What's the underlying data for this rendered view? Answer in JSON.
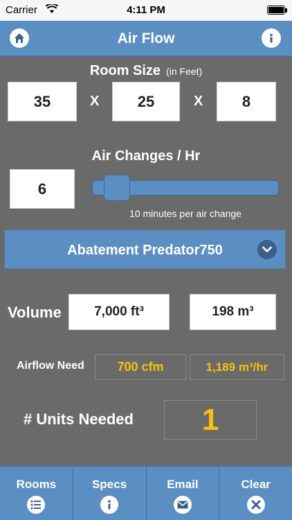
{
  "status_bar": {
    "carrier": "Carrier",
    "time": "4:11 PM"
  },
  "nav": {
    "title": "Air Flow",
    "home_icon": "home-icon",
    "info_icon": "info-icon"
  },
  "room_size": {
    "title": "Room Size",
    "unit_note": "(in Feet)",
    "length": "35",
    "width": "25",
    "height": "8",
    "separator": "X"
  },
  "air_changes": {
    "title": "Air Changes / Hr",
    "value": "6",
    "slider_level": 0.07,
    "note": "10 minutes per air change"
  },
  "unit_selector": {
    "label": "Abatement Predator750",
    "icon": "chevron-down-icon"
  },
  "volume": {
    "label": "Volume",
    "ft3": "7,000 ft³",
    "m3": "198 m³"
  },
  "airflow": {
    "label": "Airflow Need",
    "cfm": "700 cfm",
    "m3hr": "1,189 m³/hr"
  },
  "units_needed": {
    "label": "# Units Needed",
    "value": "1"
  },
  "tabs": [
    {
      "label": "Rooms",
      "icon": "list-icon"
    },
    {
      "label": "Specs",
      "icon": "info-icon"
    },
    {
      "label": "Email",
      "icon": "mail-icon"
    },
    {
      "label": "Clear",
      "icon": "close-icon"
    }
  ],
  "colors": {
    "accent": "#5b8fc4",
    "background": "#6a6a6a",
    "highlight": "#f4c20d"
  }
}
